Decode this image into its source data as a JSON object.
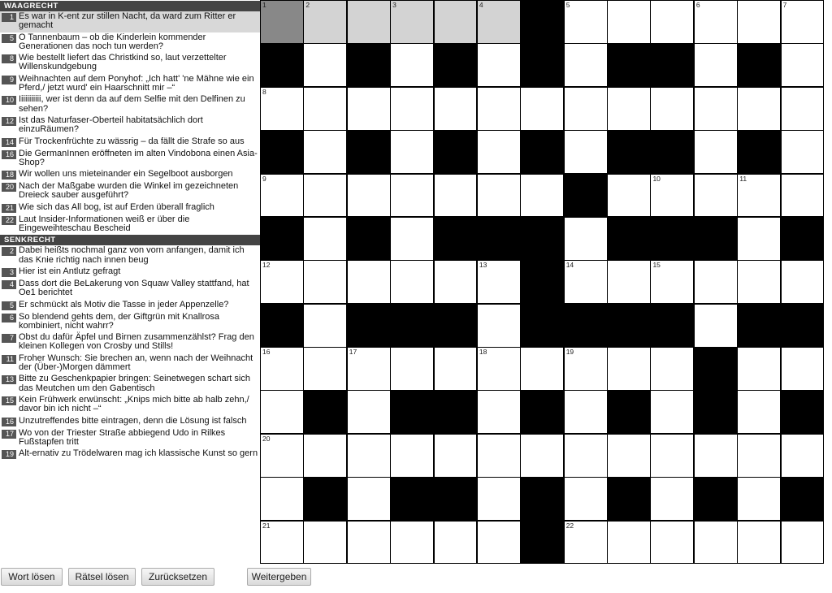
{
  "clues": {
    "across_title": "WAAGRECHT",
    "down_title": "SENKRECHT",
    "across": [
      {
        "num": "1",
        "text": "Es war in K-ent zur stillen Nacht, da ward zum Ritter er gemacht",
        "active": true
      },
      {
        "num": "5",
        "text": "O Tannenbaum – ob die Kinderlein kommender Generationen das noch tun werden?"
      },
      {
        "num": "8",
        "text": "Wie bestellt liefert das Christkind so, laut verzettelter Willenskundgebung"
      },
      {
        "num": "9",
        "text": "Weihnachten auf dem Ponyhof: „Ich hatt' 'ne Mähne wie ein Pferd,/ jetzt wurd' ein Haarschnitt mir –“"
      },
      {
        "num": "10",
        "text": "Iiiiiiiiiii, wer ist denn da auf dem Selfie mit den Delfinen zu sehen?"
      },
      {
        "num": "12",
        "text": "Ist das Naturfaser-Oberteil habitatsächlich dort einzuRäumen?"
      },
      {
        "num": "14",
        "text": "Für Trockenfrüchte zu wässrig – da fällt die Strafe so aus"
      },
      {
        "num": "16",
        "text": "Die GermanInnen eröffneten im alten Vindobona einen Asia-Shop?"
      },
      {
        "num": "18",
        "text": "Wir wollen uns mieteinander ein Segelboot ausborgen"
      },
      {
        "num": "20",
        "text": "Nach der Maßgabe wurden die Winkel im gezeichneten Dreieck sauber ausgeführt?"
      },
      {
        "num": "21",
        "text": "Wie sich das All bog, ist auf Erden überall fraglich"
      },
      {
        "num": "22",
        "text": "Laut Insider-Informationen weiß er über die Eingeweihteschau Bescheid"
      }
    ],
    "down": [
      {
        "num": "2",
        "text": "Dabei heißts nochmal ganz von vorn anfangen, damit ich das Knie richtig nach innen beug"
      },
      {
        "num": "3",
        "text": "Hier ist ein Antlutz gefragt"
      },
      {
        "num": "4",
        "text": "Dass dort die BeLakerung von Squaw Valley stattfand, hat Oe1 berichtet"
      },
      {
        "num": "5",
        "text": "Er schmückt als Motiv die Tasse in jeder Appenzelle?"
      },
      {
        "num": "6",
        "text": "So blendend gehts dem, der Giftgrün mit Knallrosa kombiniert, nicht wahrr?"
      },
      {
        "num": "7",
        "text": "Obst du dafür Äpfel und Birnen zusammenzählst? Frag den kleinen Kollegen von Crosby und Stills!"
      },
      {
        "num": "11",
        "text": "Froher Wunsch: Sie brechen an, wenn nach der Weihnacht der (Über-)Morgen dämmert"
      },
      {
        "num": "13",
        "text": "Bitte zu Geschenkpapier bringen: Seinetwegen schart sich das Meutchen um den Gabentisch"
      },
      {
        "num": "15",
        "text": "Kein Frühwerk erwünscht: „Knips mich bitte ab halb zehn,/ davor bin ich nicht –“"
      },
      {
        "num": "16",
        "text": "Unzutreffendes bitte eintragen, denn die Lösung ist falsch"
      },
      {
        "num": "17",
        "text": "Wo von der Triester Straße abbiegend Udo in Rilkes Fußstapfen tritt"
      },
      {
        "num": "19",
        "text": "Alt-ernativ zu Trödelwaren mag ich klassische Kunst so gern"
      }
    ]
  },
  "grid": {
    "rows": [
      "......#......",
      "#.#.#.#.##.#.",
      ".............",
      "#.#.#.#.##.#.",
      ".......#.....",
      "#.#.###.###.#",
      "......#......",
      "#.###.####.##",
      "..........#..",
      ".#.##.#.#.#.#",
      ".............",
      ".#.##.#.#.#.#",
      "......#......"
    ],
    "numbers": [
      [
        0,
        0,
        "1"
      ],
      [
        0,
        1,
        "2"
      ],
      [
        0,
        3,
        "3"
      ],
      [
        0,
        5,
        "4"
      ],
      [
        0,
        7,
        "5"
      ],
      [
        0,
        10,
        "6"
      ],
      [
        0,
        12,
        "7"
      ],
      [
        2,
        0,
        "8"
      ],
      [
        4,
        0,
        "9"
      ],
      [
        4,
        9,
        "10"
      ],
      [
        4,
        11,
        "11"
      ],
      [
        6,
        0,
        "12"
      ],
      [
        6,
        5,
        "13"
      ],
      [
        6,
        7,
        "14"
      ],
      [
        6,
        9,
        "15"
      ],
      [
        8,
        0,
        "16"
      ],
      [
        8,
        2,
        "17"
      ],
      [
        8,
        5,
        "18"
      ],
      [
        8,
        7,
        "19"
      ],
      [
        10,
        0,
        "20"
      ],
      [
        12,
        0,
        "21"
      ],
      [
        12,
        7,
        "22"
      ]
    ],
    "selected": [
      0,
      0
    ],
    "highlighted": [
      [
        0,
        1
      ],
      [
        0,
        2
      ],
      [
        0,
        3
      ],
      [
        0,
        4
      ],
      [
        0,
        5
      ]
    ]
  },
  "buttons": {
    "solve_word": "Wort lösen",
    "solve_puzzle": "Rätsel lösen",
    "reset": "Zurücksetzen",
    "share": "Weitergeben"
  }
}
